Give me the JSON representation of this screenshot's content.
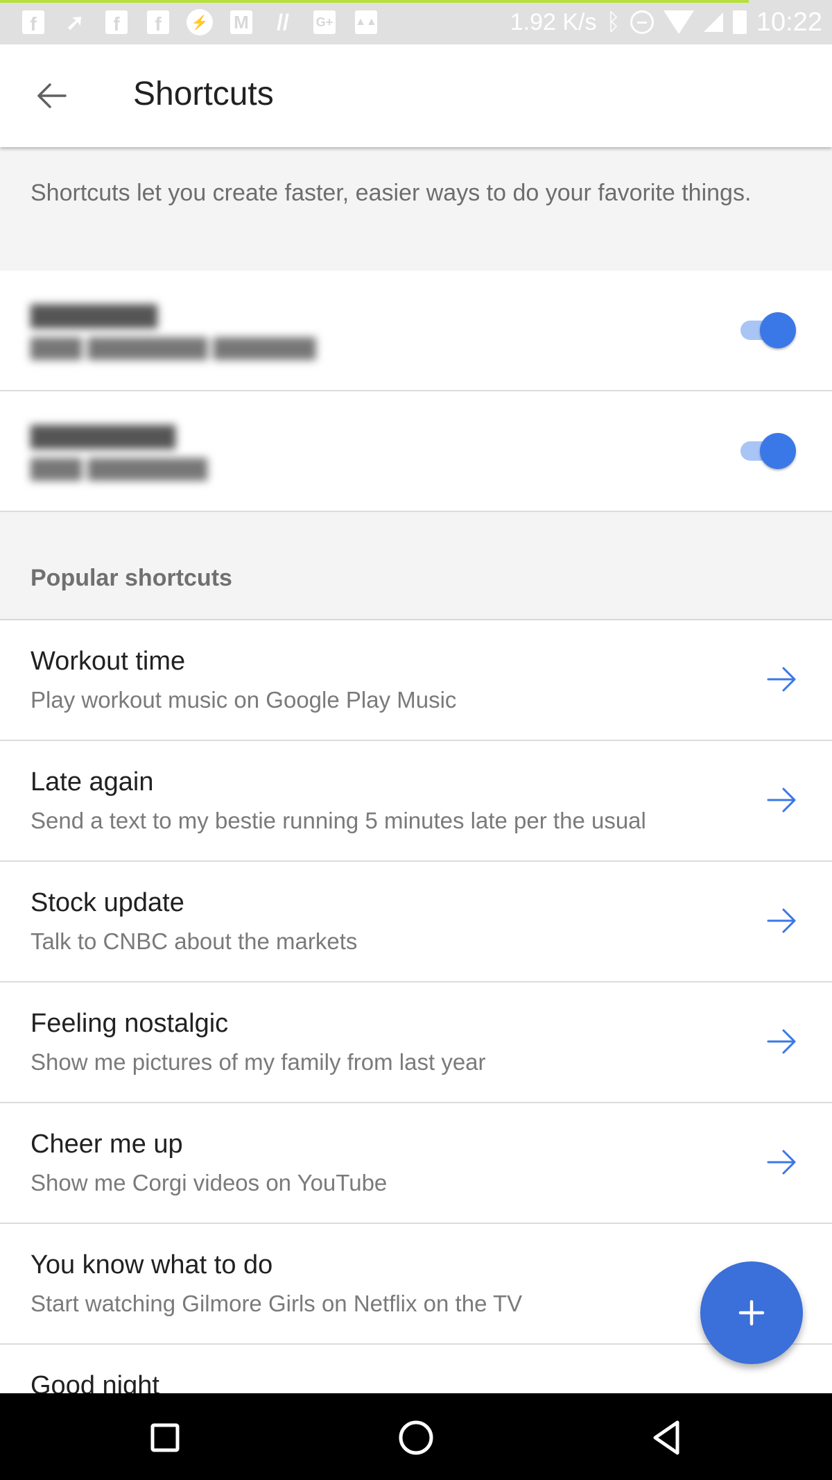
{
  "status_bar": {
    "notification_icons": [
      "facebook-icon",
      "navigation-icon",
      "facebook-icon",
      "facebook-icon",
      "messenger-icon",
      "gmail-icon",
      "app-icon",
      "google-plus-icon",
      "gallery-icon"
    ],
    "network_speed": "1.92 K/s",
    "status_icons": [
      "bluetooth-icon",
      "do-not-disturb-icon",
      "wifi-icon",
      "signal-icon",
      "battery-icon"
    ],
    "time": "10:22"
  },
  "app_bar": {
    "title": "Shortcuts",
    "back_icon": "arrow-back-icon"
  },
  "description": "Shortcuts let you create faster, easier ways to do your favorite things.",
  "personal_shortcuts": [
    {
      "title_redacted": true,
      "subtitle_redacted": true,
      "enabled": true
    },
    {
      "title_redacted": true,
      "subtitle_redacted": true,
      "enabled": true
    }
  ],
  "section_header": "Popular shortcuts",
  "popular_shortcuts": [
    {
      "title": "Workout time",
      "subtitle": "Play workout music on Google Play Music"
    },
    {
      "title": "Late again",
      "subtitle": "Send a text to my bestie running 5 minutes late per the usual"
    },
    {
      "title": "Stock update",
      "subtitle": "Talk to CNBC about the markets"
    },
    {
      "title": "Feeling nostalgic",
      "subtitle": "Show me pictures of my family from last year"
    },
    {
      "title": "Cheer me up",
      "subtitle": "Show me Corgi videos on YouTube"
    },
    {
      "title": "You know what to do",
      "subtitle": "Start watching Gilmore Girls on Netflix on the TV"
    },
    {
      "title": "Good night",
      "subtitle": ""
    }
  ],
  "fab": {
    "icon": "plus-icon",
    "label": "+"
  },
  "nav_bar": [
    "recents-icon",
    "home-icon",
    "back-icon"
  ],
  "colors": {
    "accent": "#3b78e7",
    "fab": "#3b6fd9",
    "toggle_track": "#a9c5f5",
    "section_bg": "#f4f4f4"
  }
}
